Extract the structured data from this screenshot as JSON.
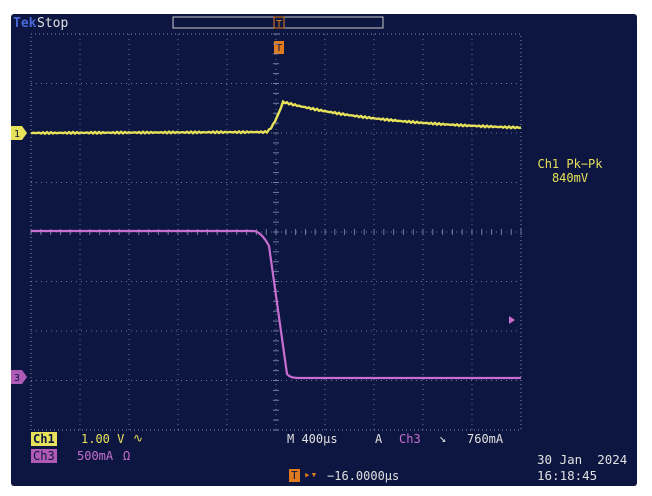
{
  "header": {
    "brand": "Tek",
    "status": "Stop"
  },
  "colors": {
    "screen_bg": "#0c1640",
    "grid": "#8a93b0",
    "ch1": "#e8e25a",
    "ch3": "#c86ed0",
    "trigger": "#e07a1e"
  },
  "icons": {
    "trigger_position": "trigger-arrow-icon",
    "trigger_level": "trigger-level-icon",
    "ch1_ground": "ch1-marker-icon",
    "ch3_ground": "ch3-marker-icon"
  },
  "markers": {
    "ch1": "1",
    "ch3": "3",
    "trigger_t": "T"
  },
  "measurement": {
    "label": "Ch1 Pk−Pk",
    "value": "840mV"
  },
  "settings": {
    "ch1_name": "Ch1",
    "ch1_scale": "1.00 V",
    "ch1_coupling": "∿",
    "ch3_name": "Ch3",
    "ch3_scale": "500mA",
    "ch3_coupling": "Ω",
    "timebase": "M 400µs",
    "trigger_mode": "A",
    "trigger_source": "Ch3",
    "trigger_slope": "↘",
    "trigger_level": "760mA",
    "horizontal_position": "−16.0000µs"
  },
  "clock": {
    "date": "30 Jan  2024",
    "time": "16:18:45"
  }
}
